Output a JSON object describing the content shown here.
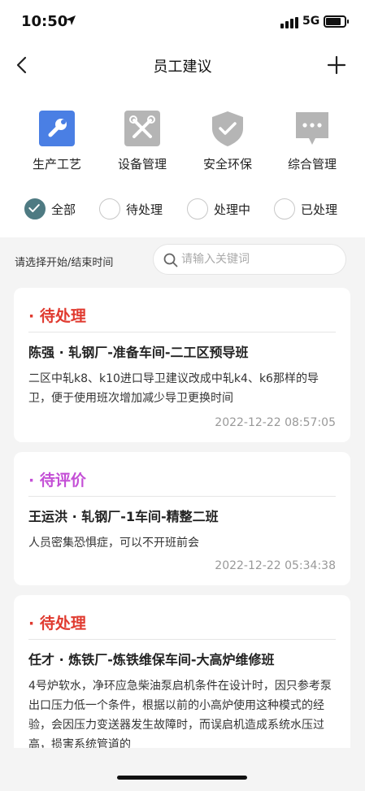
{
  "status_bar": {
    "time": "10:50",
    "network": "5G",
    "battery_level": 0.8
  },
  "nav": {
    "title": "员工建议",
    "back_icon": "chevron-left-icon",
    "add_icon": "plus-icon"
  },
  "categories": [
    {
      "label": "生产工艺",
      "icon": "wrench-icon",
      "color": "#4a7fe4"
    },
    {
      "label": "设备管理",
      "icon": "tools-icon",
      "color": "#b5b5b5"
    },
    {
      "label": "安全环保",
      "icon": "shield-icon",
      "color": "#b5b5b5"
    },
    {
      "label": "综合管理",
      "icon": "chat-icon",
      "color": "#b5b5b5"
    }
  ],
  "status_filters": [
    {
      "label": "全部",
      "selected": true
    },
    {
      "label": "待处理",
      "selected": false
    },
    {
      "label": "处理中",
      "selected": false
    },
    {
      "label": "已处理",
      "selected": false
    }
  ],
  "search": {
    "date_range_label": "请选择开始/结束时间",
    "placeholder": "请输入关键词"
  },
  "colors": {
    "pending": "#e03a2f",
    "to_evaluate": "#c44fd6",
    "accent": "#4e7a82"
  },
  "cards": [
    {
      "status": "· 待处理",
      "title": "陈强 · 轧钢厂-准备车间-二工区预导班",
      "description": "二区中轧k8、k10进口导卫建议改成中轧k4、k6那样的导卫，便于使用班次增加减少导卫更换时间",
      "time": "2022-12-22 08:57:05"
    },
    {
      "status": "· 待评价",
      "title": "王运洪 · 轧钢厂-1车间-精整二班",
      "description": "人员密集恐惧症，可以不开班前会",
      "time": "2022-12-22 05:34:38"
    },
    {
      "status": "· 待处理",
      "title": "任才 · 炼铁厂-炼铁维保车间-大高炉维修班",
      "description": "4号炉软水，净环应急柴油泵启机条件在设计时，因只参考泵出口压力低一个条件，根据以前的小高炉使用这种模式的经验，会因压力变送器发生故障时，而误启机造成系统水压过高，损害系统管道的",
      "time": ""
    }
  ]
}
